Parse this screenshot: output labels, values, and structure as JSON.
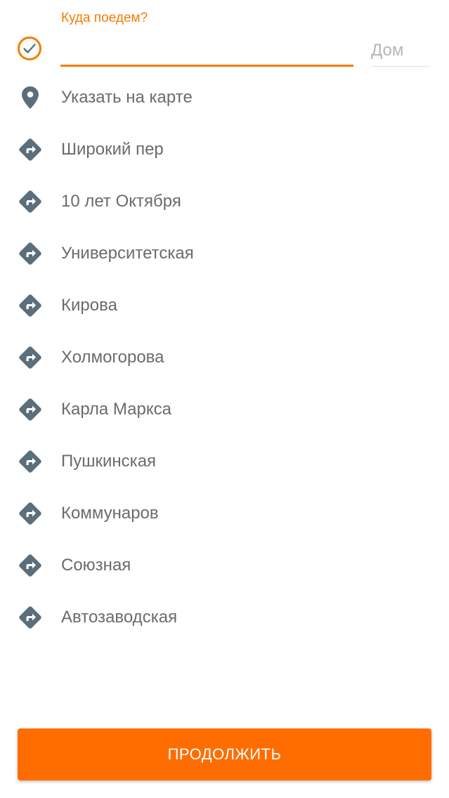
{
  "header": {
    "destination_label": "Куда поедем?",
    "destination_value": "",
    "house_placeholder": "Дом"
  },
  "icons": {
    "status": "check-circle-icon",
    "map_pick": "map-pin-icon",
    "route": "turn-right-icon"
  },
  "colors": {
    "accent": "#f57c00",
    "button": "#ff6d00",
    "icon": "#5a6e7b",
    "text": "#6b6b6b"
  },
  "list": {
    "map_pick_label": "Указать на карте",
    "streets": [
      "Широкий пер",
      "10 лет Октября",
      "Университетская",
      "Кирова",
      "Холмогорова",
      "Карла Маркса",
      "Пушкинская",
      "Коммунаров",
      "Союзная",
      "Автозаводская"
    ]
  },
  "footer": {
    "continue_label": "ПРОДОЛЖИТЬ"
  }
}
